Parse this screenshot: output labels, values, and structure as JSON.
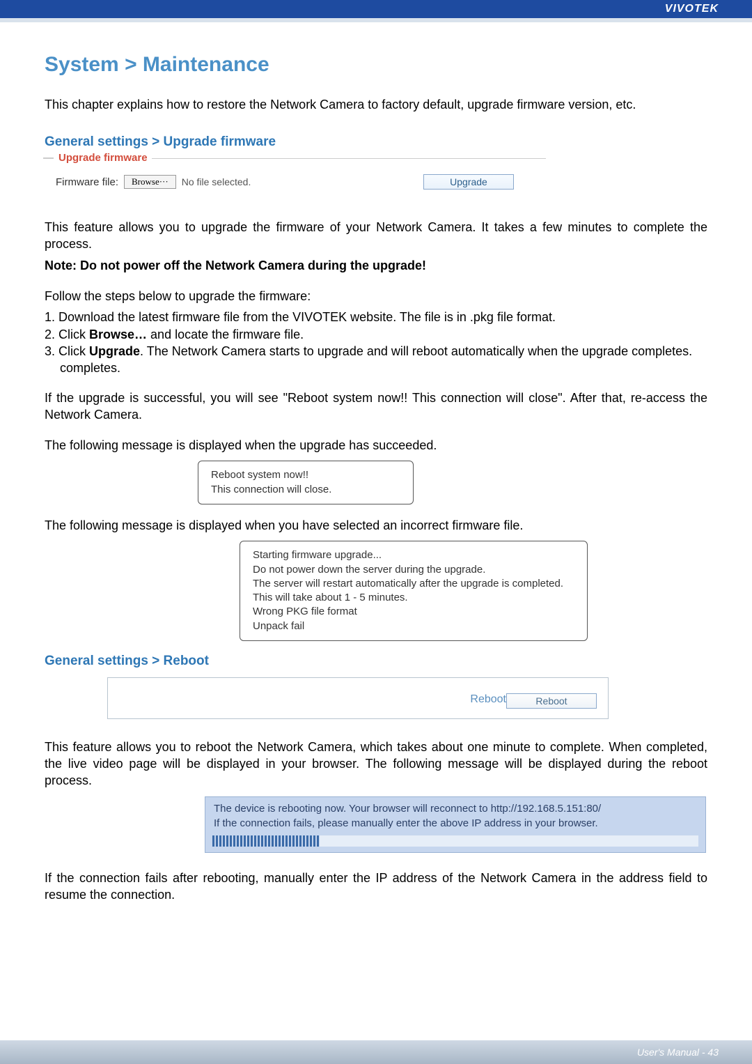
{
  "header": {
    "brand": "VIVOTEK"
  },
  "title": "System > Maintenance",
  "intro": "This chapter explains how to restore the Network Camera to factory default, upgrade firmware version, etc.",
  "upgrade": {
    "section_heading": "General settings > Upgrade firmware",
    "legend": "Upgrade firmware",
    "label": "Firmware file:",
    "browse": "Browse···",
    "nofile": "No file selected.",
    "button": "Upgrade",
    "para1": "This feature allows you to upgrade the firmware of your Network Camera. It takes a few minutes to complete the process.",
    "note": "Note: Do not power off the Network Camera during the upgrade!",
    "steps_intro": "Follow the steps below to upgrade the firmware:",
    "step1": "1. Download the latest firmware file from the VIVOTEK website. The file is in .pkg file format.",
    "step2a": "2. Click ",
    "step2b": "Browse…",
    "step2c": " and locate the firmware file.",
    "step3a": "3. Click ",
    "step3b": "Upgrade",
    "step3c": ". The Network Camera starts to upgrade and will reboot automatically when the upgrade completes.",
    "success_para": "If the upgrade is successful, you will see \"Reboot system now!! This connection will close\". After that, re-access the Network Camera.",
    "success_intro": "The following message is displayed when the upgrade has succeeded.",
    "success_msg": "Reboot system now!!\nThis connection will close.",
    "fail_intro": "The following message is displayed when you have selected an incorrect firmware file.",
    "fail_msg": "Starting firmware upgrade...\nDo not power down the server during the upgrade.\nThe server will restart automatically after the upgrade is completed.\nThis will take about 1 - 5 minutes.\nWrong PKG file format\nUnpack fail"
  },
  "reboot": {
    "section_heading": "General settings > Reboot",
    "legend": "Reboot",
    "button": "Reboot",
    "para1": "This feature allows you to reboot the Network Camera, which takes about one minute to complete. When completed, the live video page will be displayed in your browser. The following message will be displayed during the reboot process.",
    "msg_line1": "The device is rebooting now. Your browser will reconnect to http://192.168.5.151:80/",
    "msg_line2": "If the connection fails, please manually enter the above IP address in your browser.",
    "para2": "If the connection fails after rebooting, manually enter the IP address of the Network Camera in the address field to resume the connection."
  },
  "footer": {
    "text": "User's Manual - 43"
  }
}
